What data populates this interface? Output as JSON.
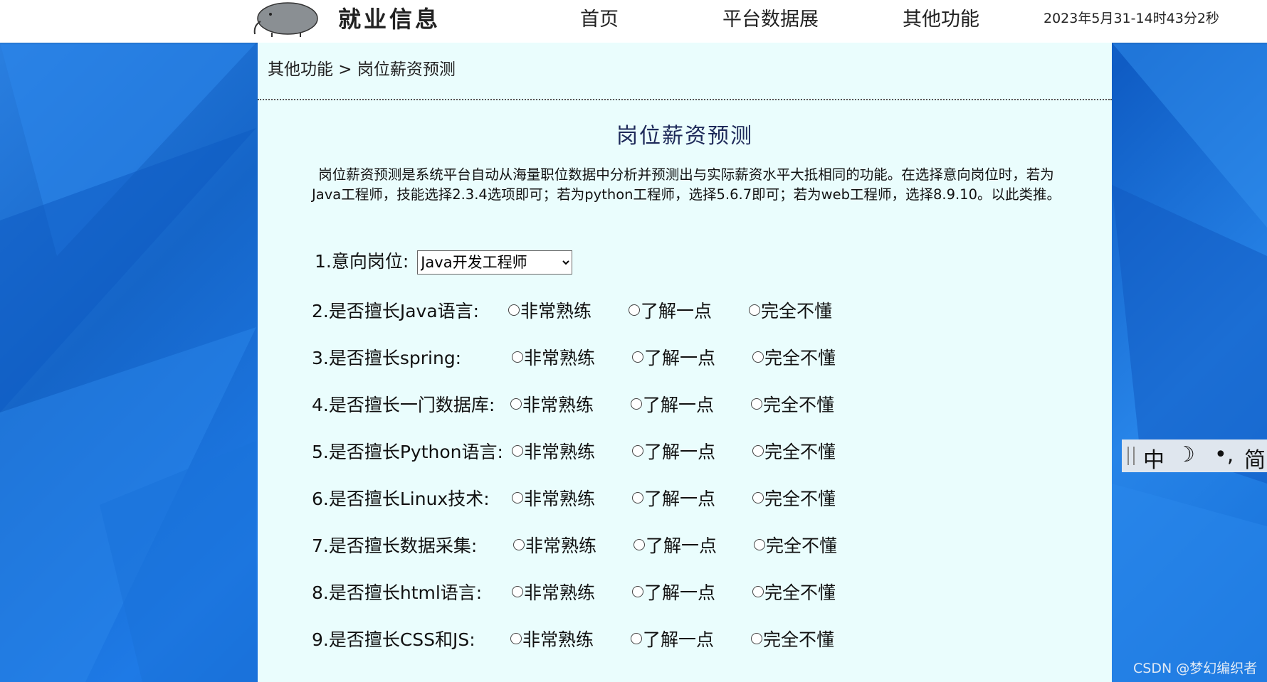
{
  "header": {
    "brand": "就业信息",
    "nav": [
      "首页",
      "平台数据展",
      "其他功能"
    ],
    "clock": "2023年5月31-14时43分2秒"
  },
  "breadcrumb": "其他功能 > 岗位薪资预测",
  "page": {
    "title": "岗位薪资预测",
    "description_line1": "岗位薪资预测是系统平台自动从海量职位数据中分析并预测出与实际薪资水平大抵相同的功能。在选择意向岗位时，若为",
    "description_line2": "Java工程师，技能选择2.3.4选项即可；若为python工程师，选择5.6.7即可；若为web工程师，选择8.9.10。以此类推。"
  },
  "form": {
    "q1_label": "1.意向岗位:",
    "q1_selected": "Java开发工程师",
    "options": [
      "非常熟练",
      "了解一点",
      "完全不懂"
    ],
    "questions": [
      "2.是否擅长Java语言:",
      "3.是否擅长spring:",
      "4.是否擅长一门数据库:",
      "5.是否擅长Python语言:",
      "6.是否擅长Linux技术:",
      "7.是否擅长数据采集:",
      "8.是否擅长html语言:",
      "9.是否擅长CSS和JS:"
    ]
  },
  "ime": {
    "mode": "中",
    "moon": "☽",
    "punct": "•,",
    "simplified": "简"
  },
  "watermark": "CSDN @梦幻编织者",
  "colors": {
    "panel": "#eafdfd",
    "background": "#1a6fd6",
    "title": "#1e2a5a"
  }
}
